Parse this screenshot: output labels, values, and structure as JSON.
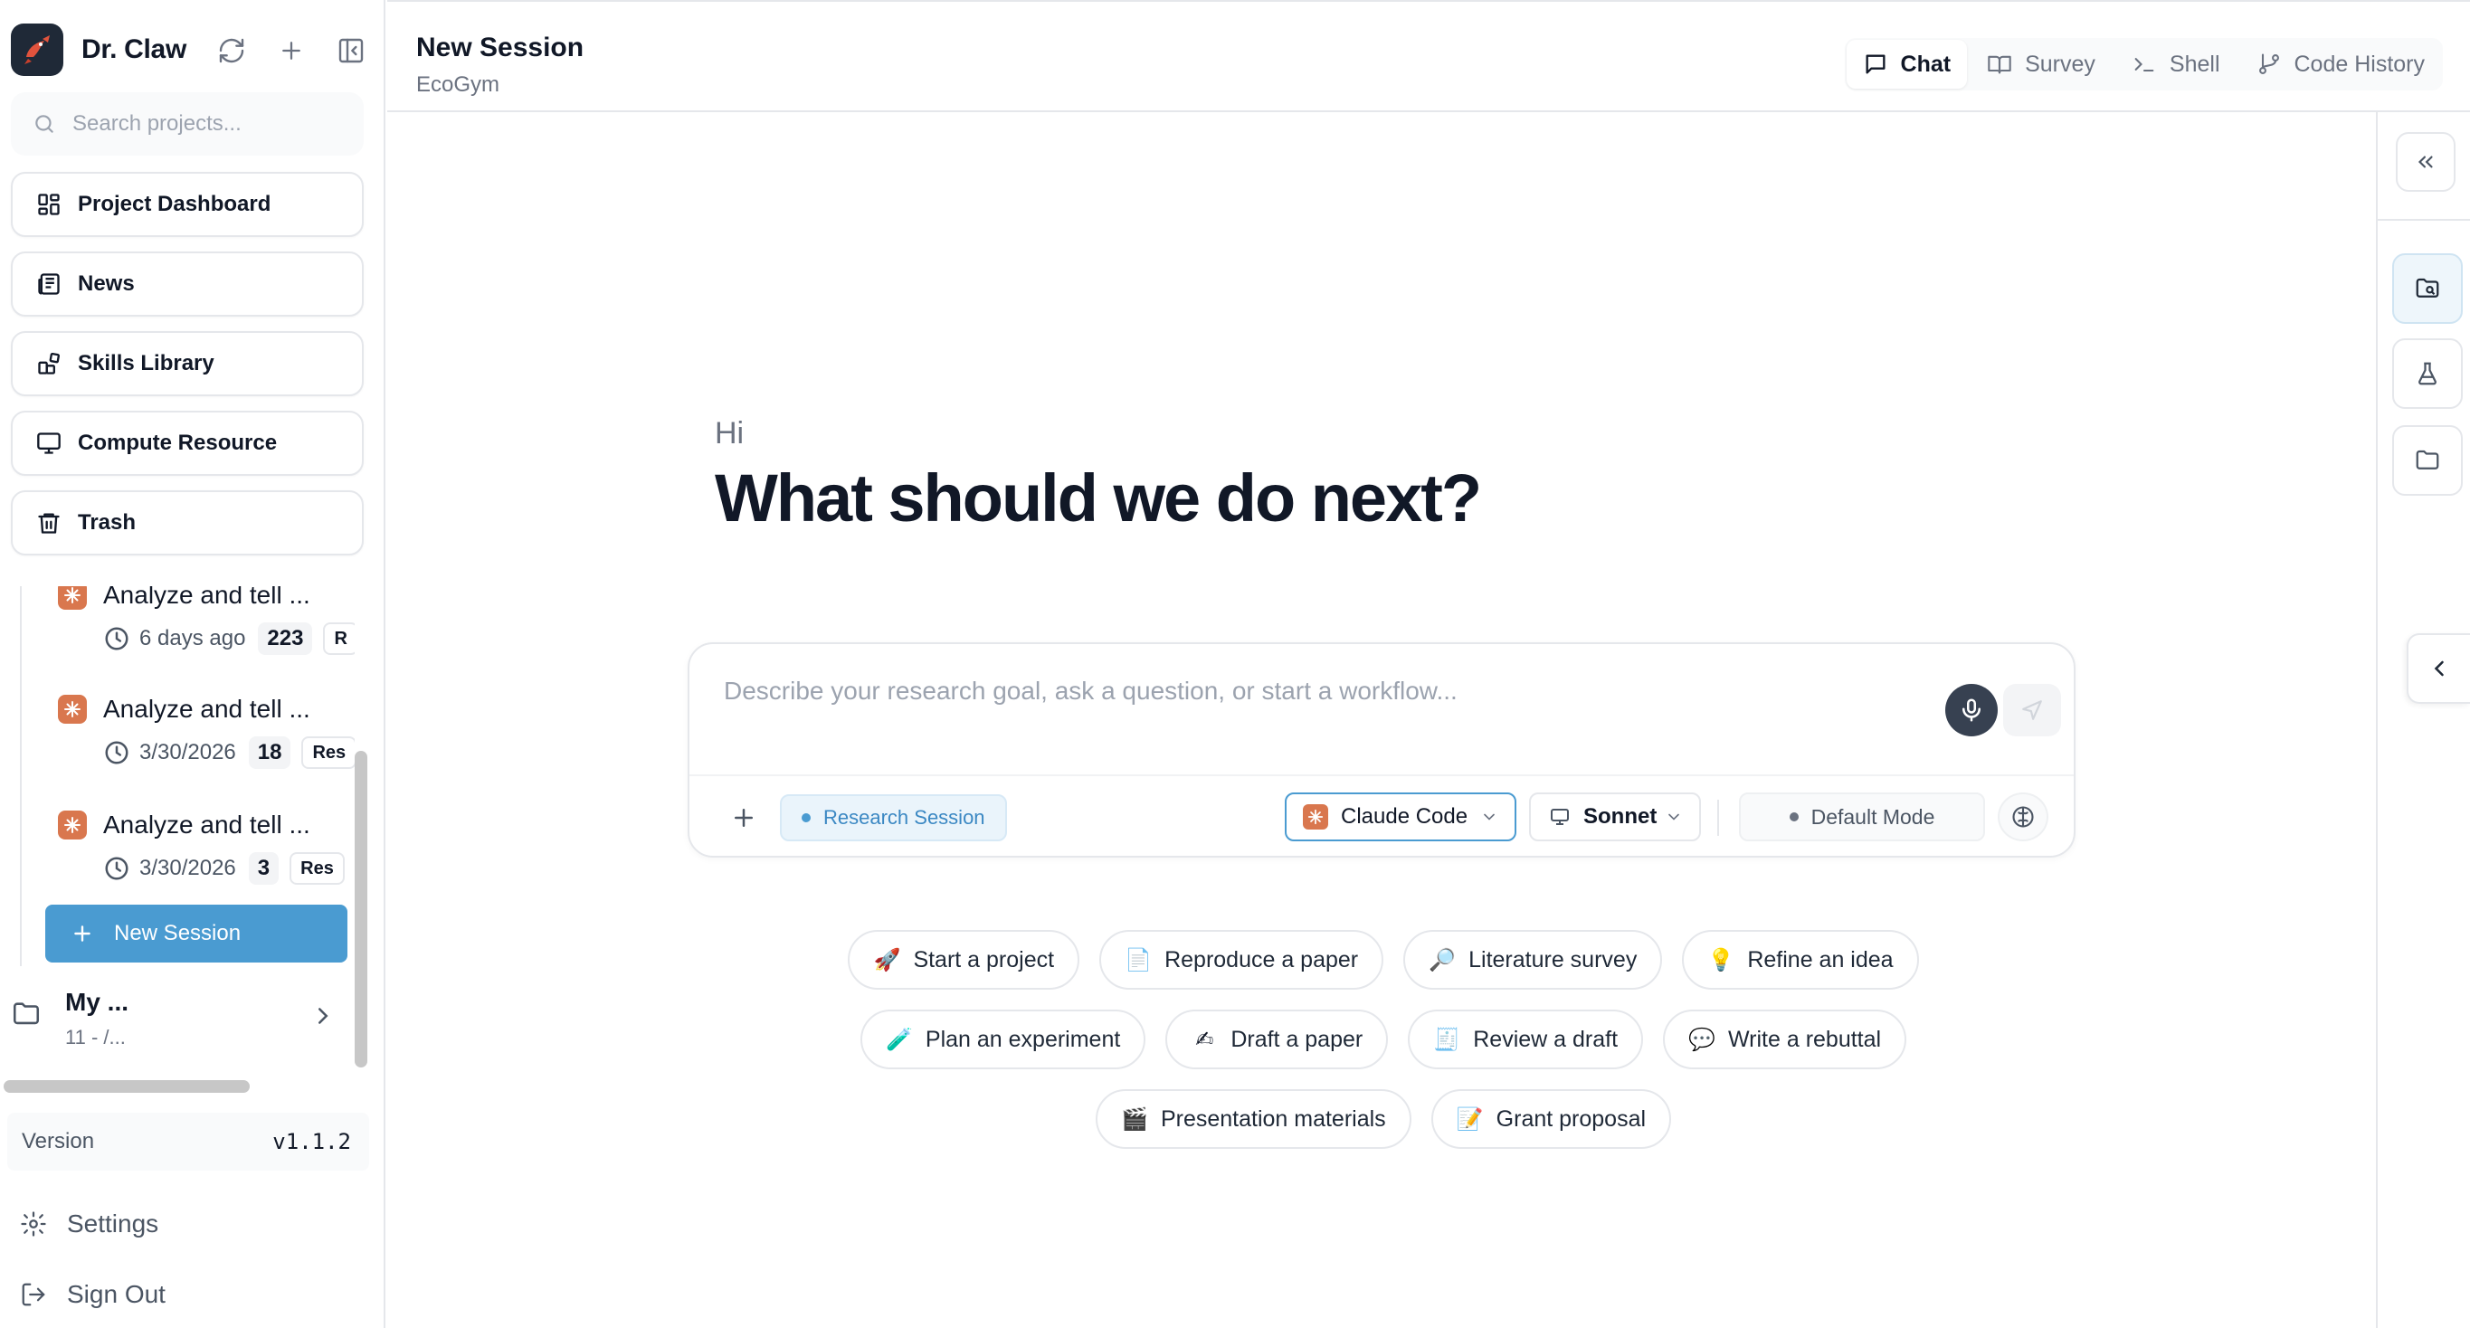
{
  "sidebar": {
    "brand_name": "Dr. Claw",
    "search": {
      "placeholder": "Search projects...",
      "value": ""
    },
    "nav": [
      {
        "label": "Project Dashboard",
        "icon": "dashboard-icon"
      },
      {
        "label": "News",
        "icon": "newspaper-icon"
      },
      {
        "label": "Skills Library",
        "icon": "skills-icon"
      },
      {
        "label": "Compute Resource",
        "icon": "monitor-icon"
      },
      {
        "label": "Trash",
        "icon": "trash-icon"
      }
    ],
    "sessions": [
      {
        "title": "Analyze and tell ...",
        "date": "6 days ago",
        "count": "223",
        "tag": "R"
      },
      {
        "title": "Analyze and tell ...",
        "date": "3/30/2026",
        "count": "18",
        "tag": "Res"
      },
      {
        "title": "Analyze and tell ...",
        "date": "3/30/2026",
        "count": "3",
        "tag": "Res"
      }
    ],
    "new_session_label": "New Session",
    "project": {
      "name": "My ...",
      "meta": "11  - /..."
    },
    "version_label": "Version",
    "version_value": "v1.1.2",
    "settings_label": "Settings",
    "signout_label": "Sign Out"
  },
  "header": {
    "title": "New Session",
    "subtitle": "EcoGym",
    "tabs": [
      {
        "label": "Chat",
        "icon": "chat-icon",
        "active": true
      },
      {
        "label": "Survey",
        "icon": "book-icon",
        "active": false
      },
      {
        "label": "Shell",
        "icon": "terminal-icon",
        "active": false
      },
      {
        "label": "Code History",
        "icon": "git-branch-icon",
        "active": false
      }
    ]
  },
  "main": {
    "greeting_small": "Hi",
    "greeting_large": "What should we do next?",
    "composer": {
      "placeholder": "Describe your research goal, ask a question, or start a workflow...",
      "value": "",
      "session_type": "Research Session",
      "agent": "Claude Code",
      "model": "Sonnet",
      "mode": "Default Mode"
    },
    "suggestions": [
      [
        {
          "emoji": "🚀",
          "label": "Start a project"
        },
        {
          "emoji": "📄",
          "label": "Reproduce a paper"
        },
        {
          "emoji": "🔎",
          "label": "Literature survey"
        },
        {
          "emoji": "💡",
          "label": "Refine an idea"
        }
      ],
      [
        {
          "emoji": "🧪",
          "label": "Plan an experiment"
        },
        {
          "emoji": "✍",
          "label": "Draft a paper"
        },
        {
          "emoji": "🧾",
          "label": "Review a draft"
        },
        {
          "emoji": "💬",
          "label": "Write a rebuttal"
        }
      ],
      [
        {
          "emoji": "🎬",
          "label": "Presentation materials"
        },
        {
          "emoji": "📝",
          "label": "Grant proposal"
        }
      ]
    ]
  },
  "colors": {
    "accent": "#4a9bd1",
    "claude_orange": "#d9774e",
    "research_pill_text": "#3b88c3",
    "border": "#e5e7eb"
  }
}
